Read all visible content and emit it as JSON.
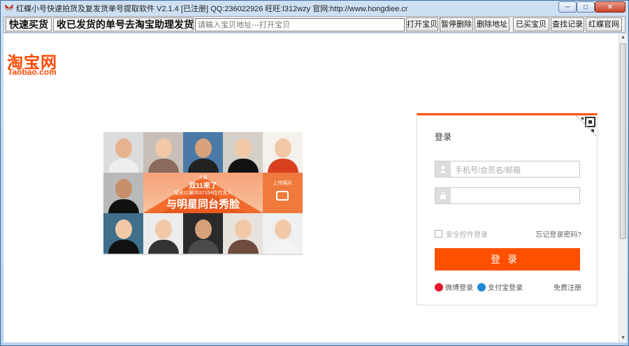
{
  "window": {
    "title": "红蝶小号快速拍货及复发货单号提取软件 V2.1.4 [已注册] QQ:236022926 旺旺:l312wzy 官网:http://www.hongdiee.cn",
    "minimize_glyph": "─",
    "maximize_glyph": "□",
    "close_glyph": "✕"
  },
  "toolbar": {
    "quick_buy": "快速买货",
    "hint": "收已发货的单号去淘宝助理发货",
    "url_placeholder": "请输入宝贝地址---打开宝贝",
    "buttons": [
      "打开宝贝",
      "暂停删除",
      "删除地址",
      "已买宝贝",
      "查找记录",
      "红蝶官网"
    ]
  },
  "logo": {
    "cn": "淘宝网",
    "en": "Taobao.com"
  },
  "banner": {
    "brand": "天猫",
    "event": "双11来了",
    "subtitle": "搜索11第2637154位代言人",
    "main": "与明星同台秀脸",
    "upload": "上传照片"
  },
  "login": {
    "title": "登录",
    "username_placeholder": "手机号/会员名/邮箱",
    "password_placeholder": "",
    "remember_label": "安全控件登录",
    "forgot_link": "忘记登录密码?",
    "submit_label": "登录",
    "weibo_label": "微博登录",
    "alipay_label": "支付宝登录",
    "register_link": "免费注册"
  },
  "colors": {
    "accent": "#ff5000",
    "logo": "#ff4a00"
  },
  "icons": {
    "user": "user-icon",
    "lock": "lock-icon",
    "weibo": "weibo-icon",
    "alipay": "alipay-icon",
    "qr": "qr-code-icon",
    "camera": "camera-icon"
  }
}
